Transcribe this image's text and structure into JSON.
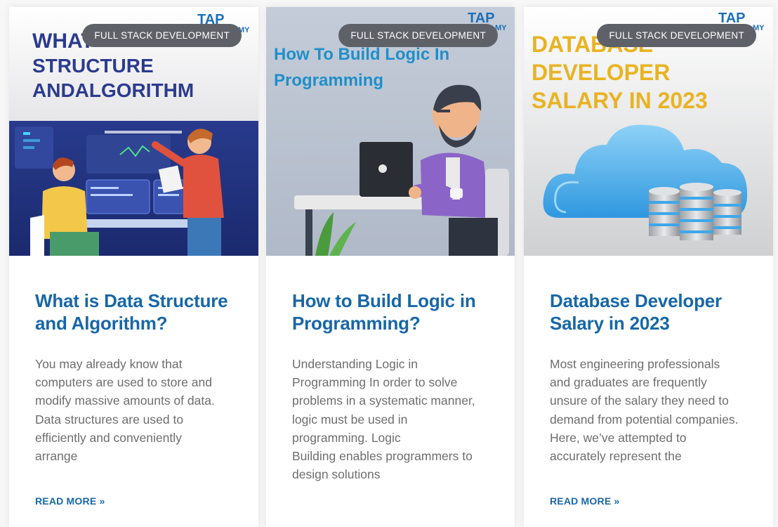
{
  "cards": [
    {
      "category": "FULL STACK DEVELOPMENT",
      "image_text": {
        "line1": "WHAT",
        "line2": "STRUCTURE",
        "line3": "ANDALGORITHM",
        "brand": "TAP",
        "brand_sub": "MY"
      },
      "title": "What is Data Structure and Algorithm?",
      "excerpt": "You may already know that\ncomputers are used to store and\nmodify massive amounts of data.\nData structures are used to\nefficiently and conveniently\narrange",
      "read_more": "READ MORE »"
    },
    {
      "category": "FULL STACK DEVELOPMENT",
      "image_text": {
        "line1": "How To Build Logic In",
        "line2": "Programming",
        "brand": "TAP",
        "brand_sub": "MY"
      },
      "title": "How to Build Logic in Programming?",
      "excerpt": "Understanding Logic in\nProgramming In order to solve\nproblems in a systematic manner,\nlogic must be used in\nprogramming. Logic\nBuilding enables programmers to\ndesign solutions",
      "read_more": ""
    },
    {
      "category": "FULL STACK DEVELOPMENT",
      "image_text": {
        "line1": "DATABASE",
        "line2": "DEVELOPER",
        "line3": "SALARY IN 2023",
        "brand": "TAP",
        "brand_sub": "MY"
      },
      "title": "Database Developer Salary in 2023",
      "excerpt": "Most engineering professionals\nand graduates are frequently\nunsure of the salary they need to\ndemand from potential companies.\nHere, we’ve attempted to\naccurately represent the",
      "read_more": "READ MORE »"
    }
  ],
  "colors": {
    "title": "#1767a8",
    "badge_bg": "#5f6168",
    "excerpt": "#6e6e6e",
    "img1_headline": "#2c3b8f",
    "img2_headline": "#1f8fc9",
    "img3_headline": "#e8b323"
  }
}
